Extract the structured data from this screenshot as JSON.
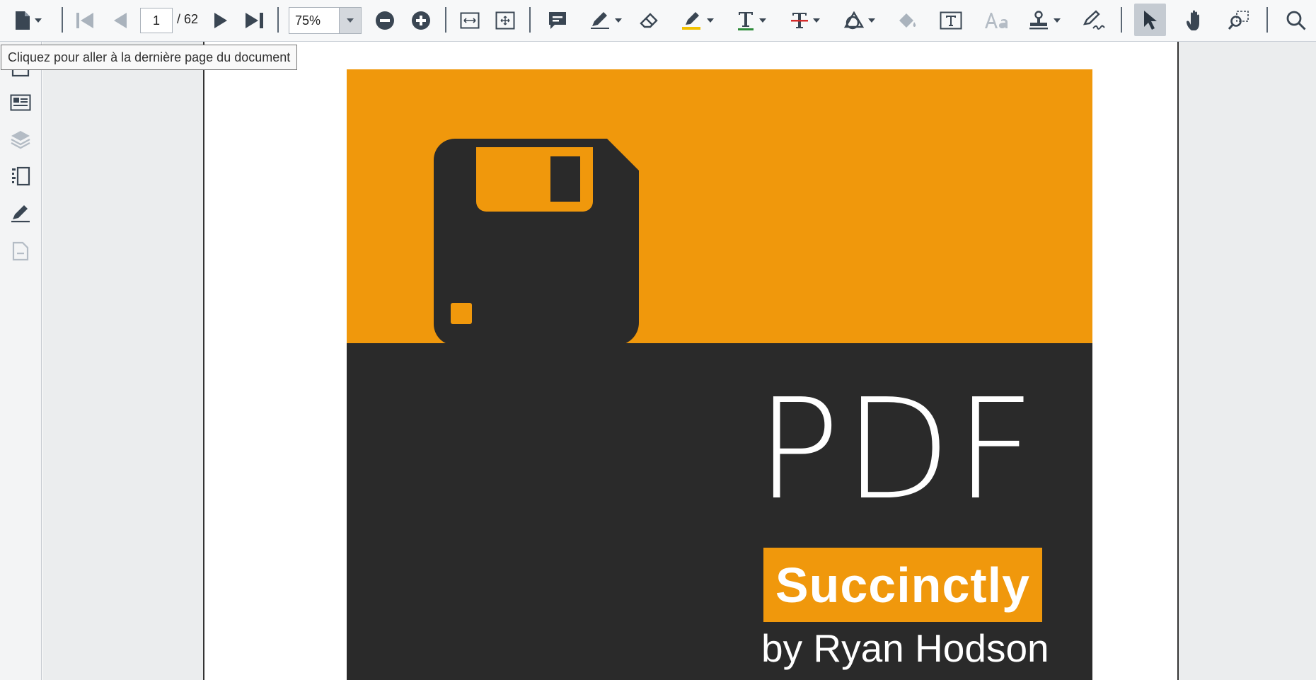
{
  "toolbar": {
    "page": {
      "current": "1",
      "total_label": "/ 62"
    },
    "zoom": {
      "value": "75%"
    }
  },
  "tooltip": {
    "text": "Cliquez pour aller à la dernière page du document"
  },
  "cover": {
    "title": "PDF",
    "series": "Succinctly",
    "author": "by Ryan Hodson",
    "colors": {
      "accent": "#f0980c",
      "dark": "#2a2a2a",
      "text": "#ffffff"
    }
  },
  "theme": {
    "icon": "#3a4653",
    "icon_disabled": "#aab3bd",
    "selected_bg": "#c5cbd2"
  }
}
